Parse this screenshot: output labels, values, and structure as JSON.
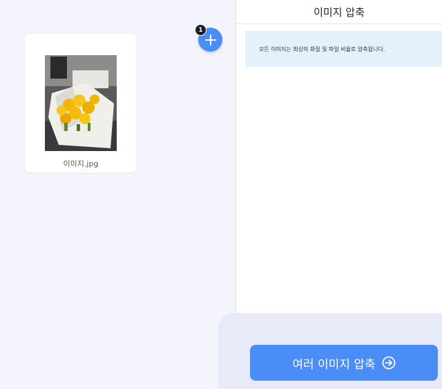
{
  "header": {
    "title": "이미지 압축"
  },
  "files": [
    {
      "name": "이미지.jpg"
    }
  ],
  "add_button": {
    "badge_count": "1",
    "icon": "plus-icon"
  },
  "info": {
    "text": "모든 이미지는 최상의 화질 및 파일 비율로 압축됩니다."
  },
  "action": {
    "label": "여러 이미지 압축",
    "icon": "arrow-right-circle-icon"
  },
  "colors": {
    "accent": "#4a8df6",
    "left_bg": "#f4f4fd",
    "info_bg": "#e3f1fd",
    "footer_bg": "#e7ebf9"
  }
}
